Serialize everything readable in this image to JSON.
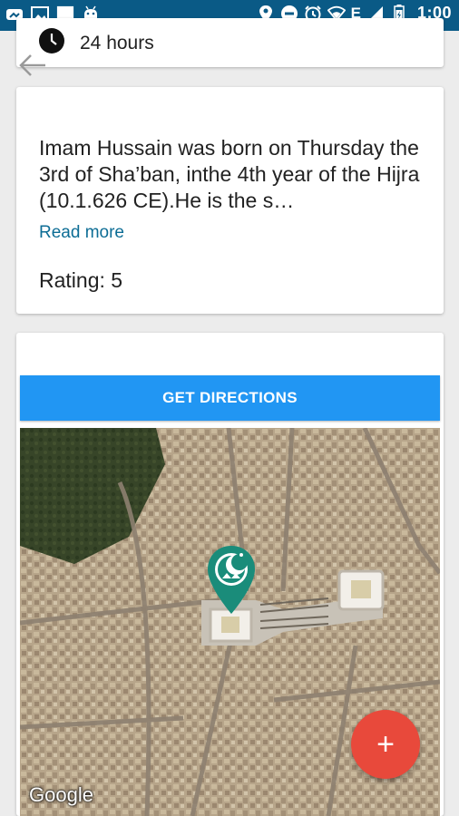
{
  "status_bar": {
    "network": "E",
    "time": "1:00"
  },
  "hours": {
    "text": "24 hours"
  },
  "description": {
    "text": "Imam Hussain was born on Thursday the 3rd of Sha’ban, inthe 4th year of the Hijra (10.1.626 CE).He is the s…",
    "read_more": "Read more",
    "rating": "Rating: 5"
  },
  "map": {
    "directions_label": "GET DIRECTIONS",
    "attribution": "Google"
  },
  "fab": {
    "label": "+"
  },
  "colors": {
    "status_bar": "#0a5a86",
    "accent": "#2196f3",
    "link": "#0d6d95",
    "fab": "#e8493b",
    "marker": "#1a8c7a"
  }
}
